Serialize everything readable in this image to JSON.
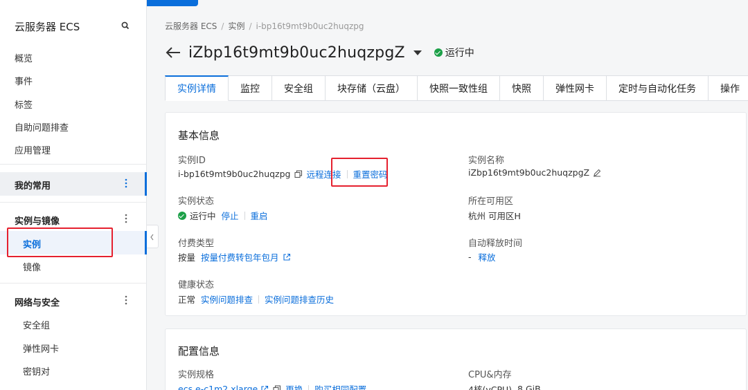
{
  "sidebar": {
    "title": "云服务器 ECS",
    "items": [
      "概览",
      "事件",
      "标签",
      "自助问题排查",
      "应用管理"
    ],
    "my_favorites": "我的常用",
    "group_instances": "实例与镜像",
    "instances": "实例",
    "images": "镜像",
    "group_network": "网络与安全",
    "security_group": "安全组",
    "eni": "弹性网卡",
    "keypair": "密钥对"
  },
  "breadcrumb": [
    "云服务器 ECS",
    "实例",
    "i-bp16t9mt9b0uc2huqzpg"
  ],
  "header": {
    "title": "iZbp16t9mt9b0uc2huqzpgZ",
    "status": "运行中"
  },
  "tabs": [
    "实例详情",
    "监控",
    "安全组",
    "块存储（云盘）",
    "快照一致性组",
    "快照",
    "弹性网卡",
    "定时与自动化任务",
    "操作"
  ],
  "basic": {
    "title": "基本信息",
    "instance_id_label": "实例ID",
    "instance_id": "i-bp16t9mt9b0uc2huqzpg",
    "remote_connect": "远程连接",
    "reset_password": "重置密码",
    "instance_name_label": "实例名称",
    "instance_name": "iZbp16t9mt9b0uc2huqzpgZ",
    "status_label": "实例状态",
    "status": "运行中",
    "stop": "停止",
    "restart": "重启",
    "zone_label": "所在可用区",
    "zone": "杭州 可用区H",
    "billing_label": "付费类型",
    "billing": "按量",
    "billing_convert": "按量付费转包年包月",
    "auto_release_label": "自动释放时间",
    "auto_release": "-",
    "release": "释放",
    "health_label": "健康状态",
    "health": "正常",
    "troubleshoot": "实例问题排查",
    "troubleshoot_history": "实例问题排查历史"
  },
  "config": {
    "title": "配置信息",
    "spec_label": "实例规格",
    "spec": "ecs.e-c1m2.xlarge",
    "change": "更换",
    "buy_same": "购买相同配置",
    "cpu_mem_label": "CPU&内存",
    "cpu": "4核(vCPU)",
    "mem": "8 GiB"
  },
  "colors": {
    "accent": "#0a6edb",
    "running": "#1ca048",
    "highlight": "#e5202e"
  }
}
